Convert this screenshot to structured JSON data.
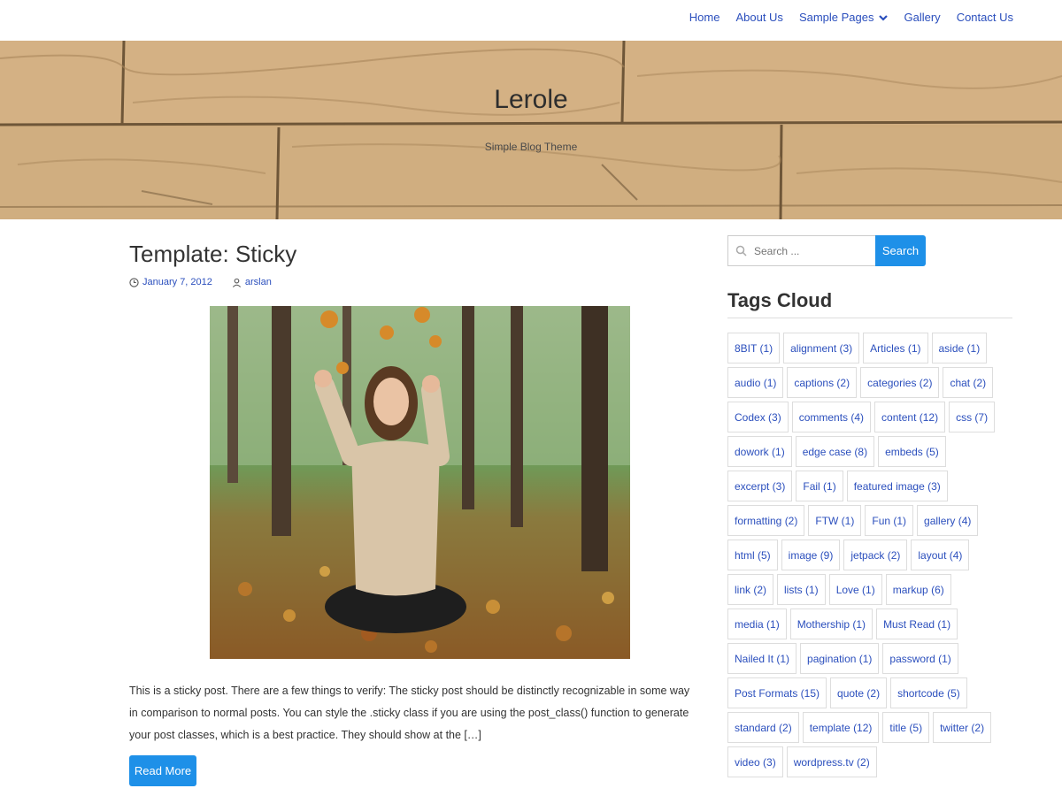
{
  "nav": {
    "items": [
      {
        "label": "Home"
      },
      {
        "label": "About Us"
      },
      {
        "label": "Sample Pages"
      },
      {
        "label": "Gallery"
      },
      {
        "label": "Contact Us"
      }
    ]
  },
  "header": {
    "title": "Lerole",
    "description": "Simple Blog Theme"
  },
  "post": {
    "title": "Template: Sticky",
    "date": "January 7, 2012",
    "author": "arslan",
    "excerpt": "This is a sticky post. There are a few things to verify: The sticky post should be distinctly recognizable in some way in comparison to normal posts. You can style the .sticky class if you are using the post_class() function to generate your post classes, which is a best practice. They should show at the […]",
    "read_more": "Read More"
  },
  "sidebar": {
    "search": {
      "placeholder": "Search ...",
      "button": "Search"
    },
    "tags_title": "Tags Cloud",
    "tags": [
      "8BIT (1)",
      "alignment (3)",
      "Articles (1)",
      "aside (1)",
      "audio (1)",
      "captions (2)",
      "categories (2)",
      "chat (2)",
      "Codex (3)",
      "comments (4)",
      "content (12)",
      "css (7)",
      "dowork (1)",
      "edge case (8)",
      "embeds (5)",
      "excerpt (3)",
      "Fail (1)",
      "featured image (3)",
      "formatting (2)",
      "FTW (1)",
      "Fun (1)",
      "gallery (4)",
      "html (5)",
      "image (9)",
      "jetpack (2)",
      "layout (4)",
      "link (2)",
      "lists (1)",
      "Love (1)",
      "markup (6)",
      "media (1)",
      "Mothership (1)",
      "Must Read (1)",
      "Nailed It (1)",
      "pagination (1)",
      "password (1)",
      "Post Formats (15)",
      "quote (2)",
      "shortcode (5)",
      "standard (2)",
      "template (12)",
      "title (5)",
      "twitter (2)",
      "video (3)",
      "wordpress.tv (2)"
    ]
  },
  "colors": {
    "accent": "#1e90e8",
    "link": "#2b4fbd"
  }
}
